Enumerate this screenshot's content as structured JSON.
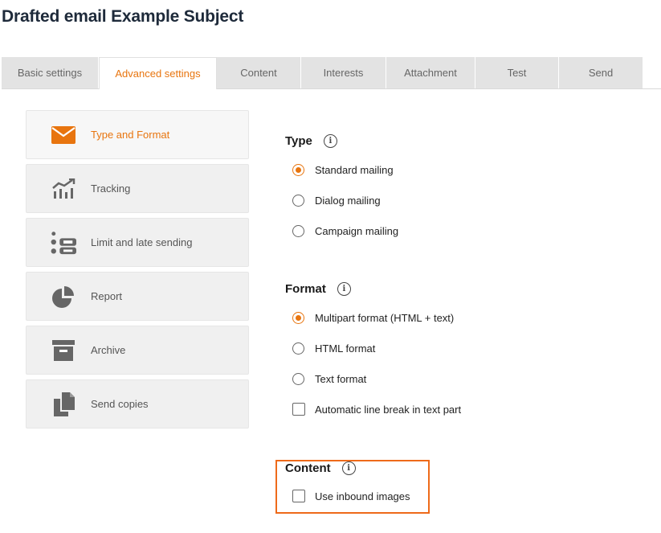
{
  "page": {
    "title": "Drafted email Example Subject"
  },
  "tabs": [
    {
      "label": "Basic settings",
      "active": false
    },
    {
      "label": "Advanced settings",
      "active": true
    },
    {
      "label": "Content",
      "active": false
    },
    {
      "label": "Interests",
      "active": false
    },
    {
      "label": "Attachment",
      "active": false
    },
    {
      "label": "Test",
      "active": false
    },
    {
      "label": "Send",
      "active": false
    }
  ],
  "sidebar": {
    "items": [
      {
        "label": "Type and Format",
        "icon": "envelope-icon",
        "active": true
      },
      {
        "label": "Tracking",
        "icon": "tracking-chart-icon",
        "active": false
      },
      {
        "label": "Limit and late sending",
        "icon": "limit-list-icon",
        "active": false
      },
      {
        "label": "Report",
        "icon": "pie-chart-icon",
        "active": false
      },
      {
        "label": "Archive",
        "icon": "archive-box-icon",
        "active": false
      },
      {
        "label": "Send copies",
        "icon": "copies-icon",
        "active": false
      }
    ]
  },
  "type_section": {
    "title": "Type",
    "options": [
      {
        "label": "Standard mailing",
        "checked": true
      },
      {
        "label": "Dialog mailing",
        "checked": false
      },
      {
        "label": "Campaign mailing",
        "checked": false
      }
    ]
  },
  "format_section": {
    "title": "Format",
    "options": [
      {
        "label": "Multipart format (HTML + text)",
        "checked": true
      },
      {
        "label": "HTML format",
        "checked": false
      },
      {
        "label": "Text format",
        "checked": false
      }
    ],
    "line_break_label": "Automatic line break in text part",
    "line_break_checked": false
  },
  "content_section": {
    "title": "Content",
    "inbound_images_label": "Use inbound images",
    "inbound_images_checked": false
  },
  "info_glyph": "i",
  "colors": {
    "accent": "#e8750f",
    "highlight": "#ee6a1a",
    "tab_bg": "#e3e3e3",
    "icon": "#666666"
  }
}
